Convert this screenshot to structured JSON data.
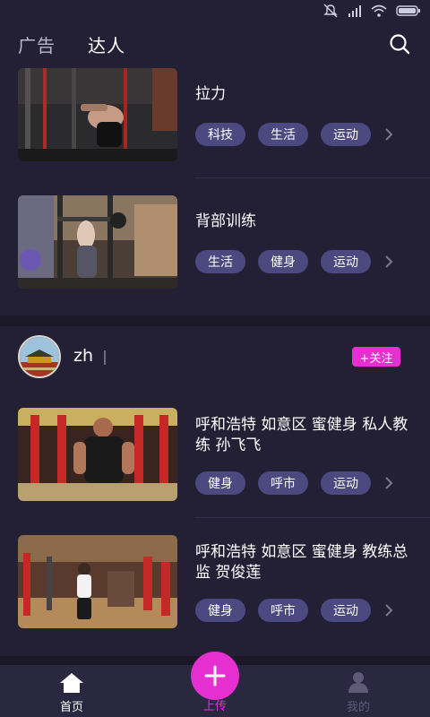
{
  "header": {
    "tabs": [
      {
        "label": "广告",
        "active": false
      },
      {
        "label": "达人",
        "active": true
      }
    ]
  },
  "feed": {
    "posts_top": [
      {
        "title": "拉力",
        "tags": [
          "科技",
          "生活",
          "运动"
        ],
        "image": "gym-cable-pull"
      },
      {
        "title": "背部训练",
        "tags": [
          "生活",
          "健身",
          "运动"
        ],
        "image": "gym-back-training"
      }
    ],
    "user": {
      "name": "zh",
      "follow_label": "+关注",
      "avatar": "building-avatar"
    },
    "posts_user": [
      {
        "title": "呼和浩特 如意区 蜜健身 私人教练 孙飞飞",
        "tags": [
          "健身",
          "呼市",
          "运动"
        ],
        "image": "gym-machine-trainer"
      },
      {
        "title": "呼和浩特 如意区 蜜健身 教练总监 贺俊莲",
        "tags": [
          "健身",
          "呼市",
          "运动"
        ],
        "image": "gym-red-machines"
      }
    ]
  },
  "nav": {
    "home_label": "首页",
    "upload_label": "上传",
    "mine_label": "我的"
  },
  "colors": {
    "background": "#232036",
    "accent": "#e62fd0",
    "tag": "#4c4880"
  },
  "icons": [
    "mute-icon",
    "signal-icon",
    "wifi-icon",
    "battery-icon",
    "search-icon",
    "chevron-right-icon",
    "home-icon",
    "plus-icon",
    "user-icon"
  ]
}
